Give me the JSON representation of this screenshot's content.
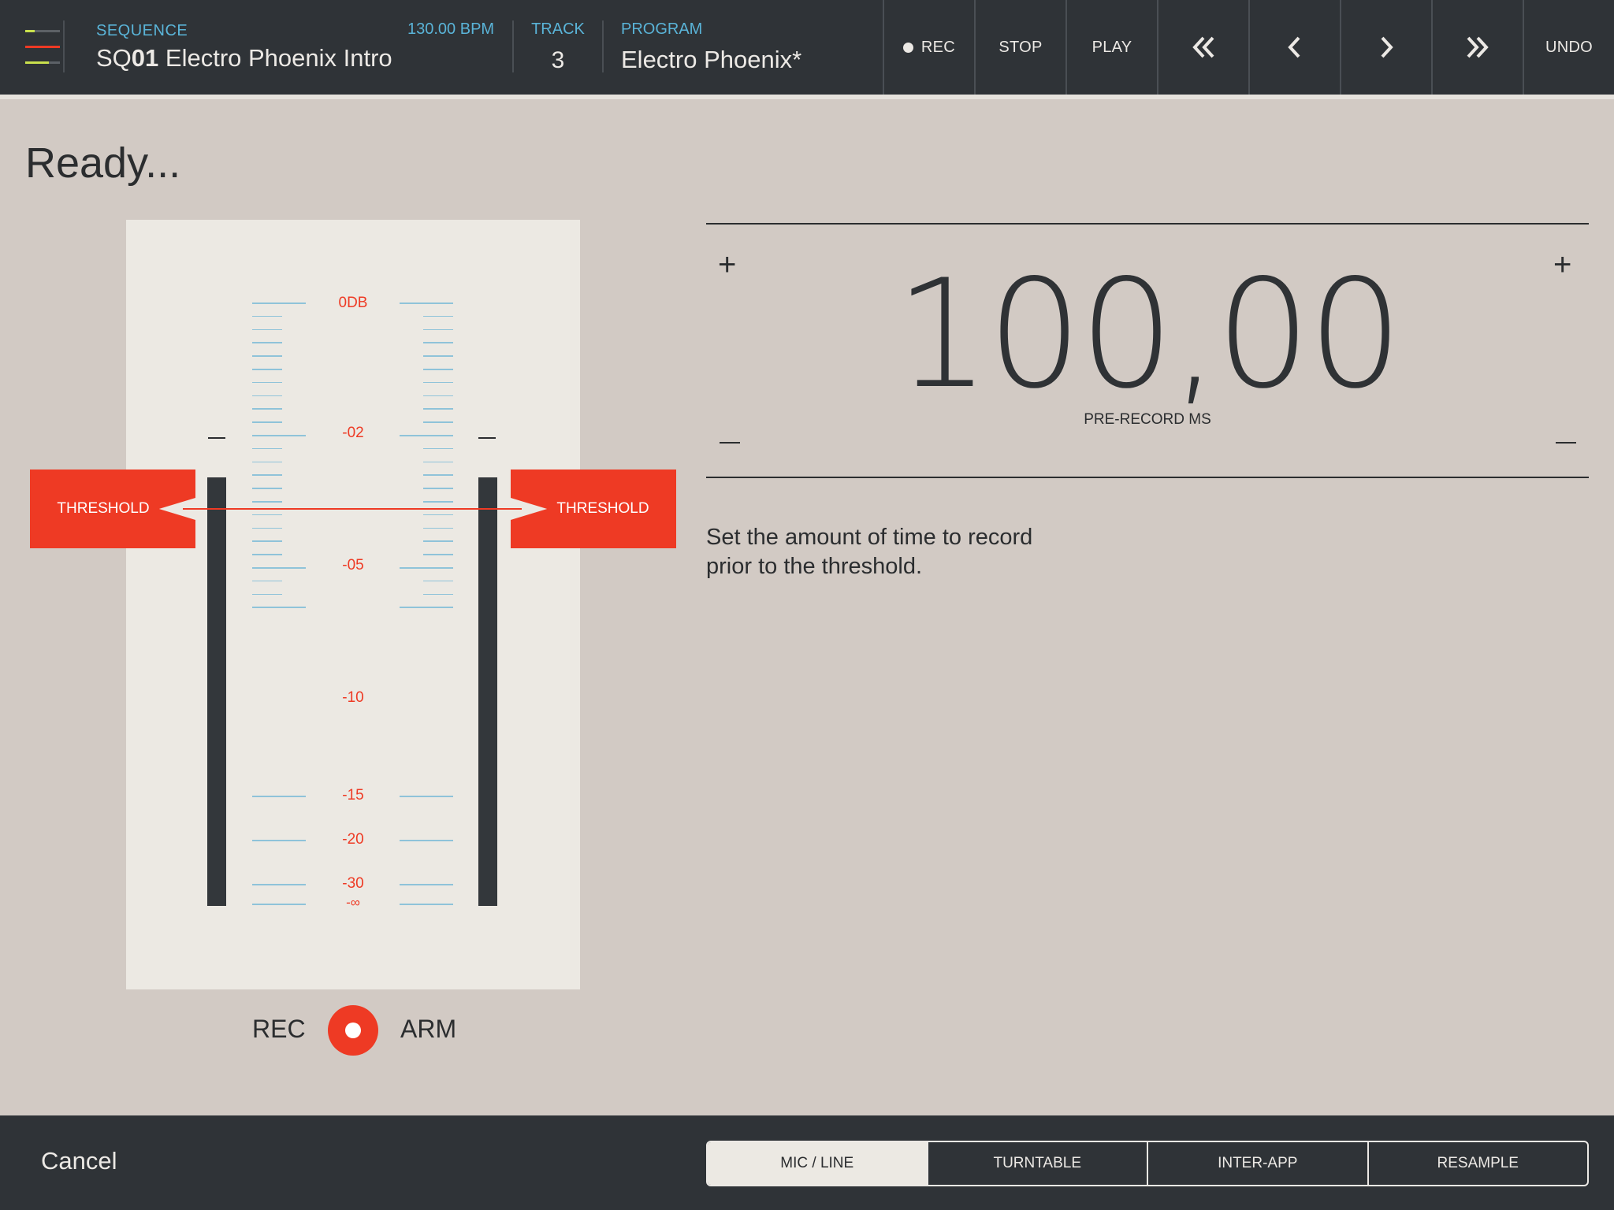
{
  "header": {
    "sequence_label": "SEQUENCE",
    "bpm": "130.00 BPM",
    "sequence_id": "SQ01",
    "sequence_id_prefix": "SQ",
    "sequence_id_number": "01",
    "sequence_name": "Electro Phoenix Intro",
    "track_label": "TRACK",
    "track_value": "3",
    "program_label": "PROGRAM",
    "program_name": "Electro Phoenix*"
  },
  "transport": {
    "rec": "REC",
    "stop": "STOP",
    "play": "PLAY",
    "undo": "UNDO"
  },
  "status": "Ready...",
  "meter": {
    "db_labels": [
      "0DB",
      "-02",
      "-05",
      "-10",
      "-15",
      "-20",
      "-30",
      "-∞"
    ],
    "threshold_label": "THRESHOLD",
    "rec_label": "REC",
    "arm_label": "ARM"
  },
  "prerecord": {
    "value": "100,00",
    "caption": "PRE-RECORD MS",
    "description": "Set the amount of time to record prior to the threshold."
  },
  "footer": {
    "cancel": "Cancel",
    "sources": [
      "MIC / LINE",
      "TURNTABLE",
      "INTER-APP",
      "RESAMPLE"
    ],
    "active_source": "MIC / LINE"
  },
  "colors": {
    "accent_red": "#ee3a24",
    "accent_blue": "#5ab4d8",
    "bar_dark": "#2f3337",
    "background": "#d2cac4"
  }
}
